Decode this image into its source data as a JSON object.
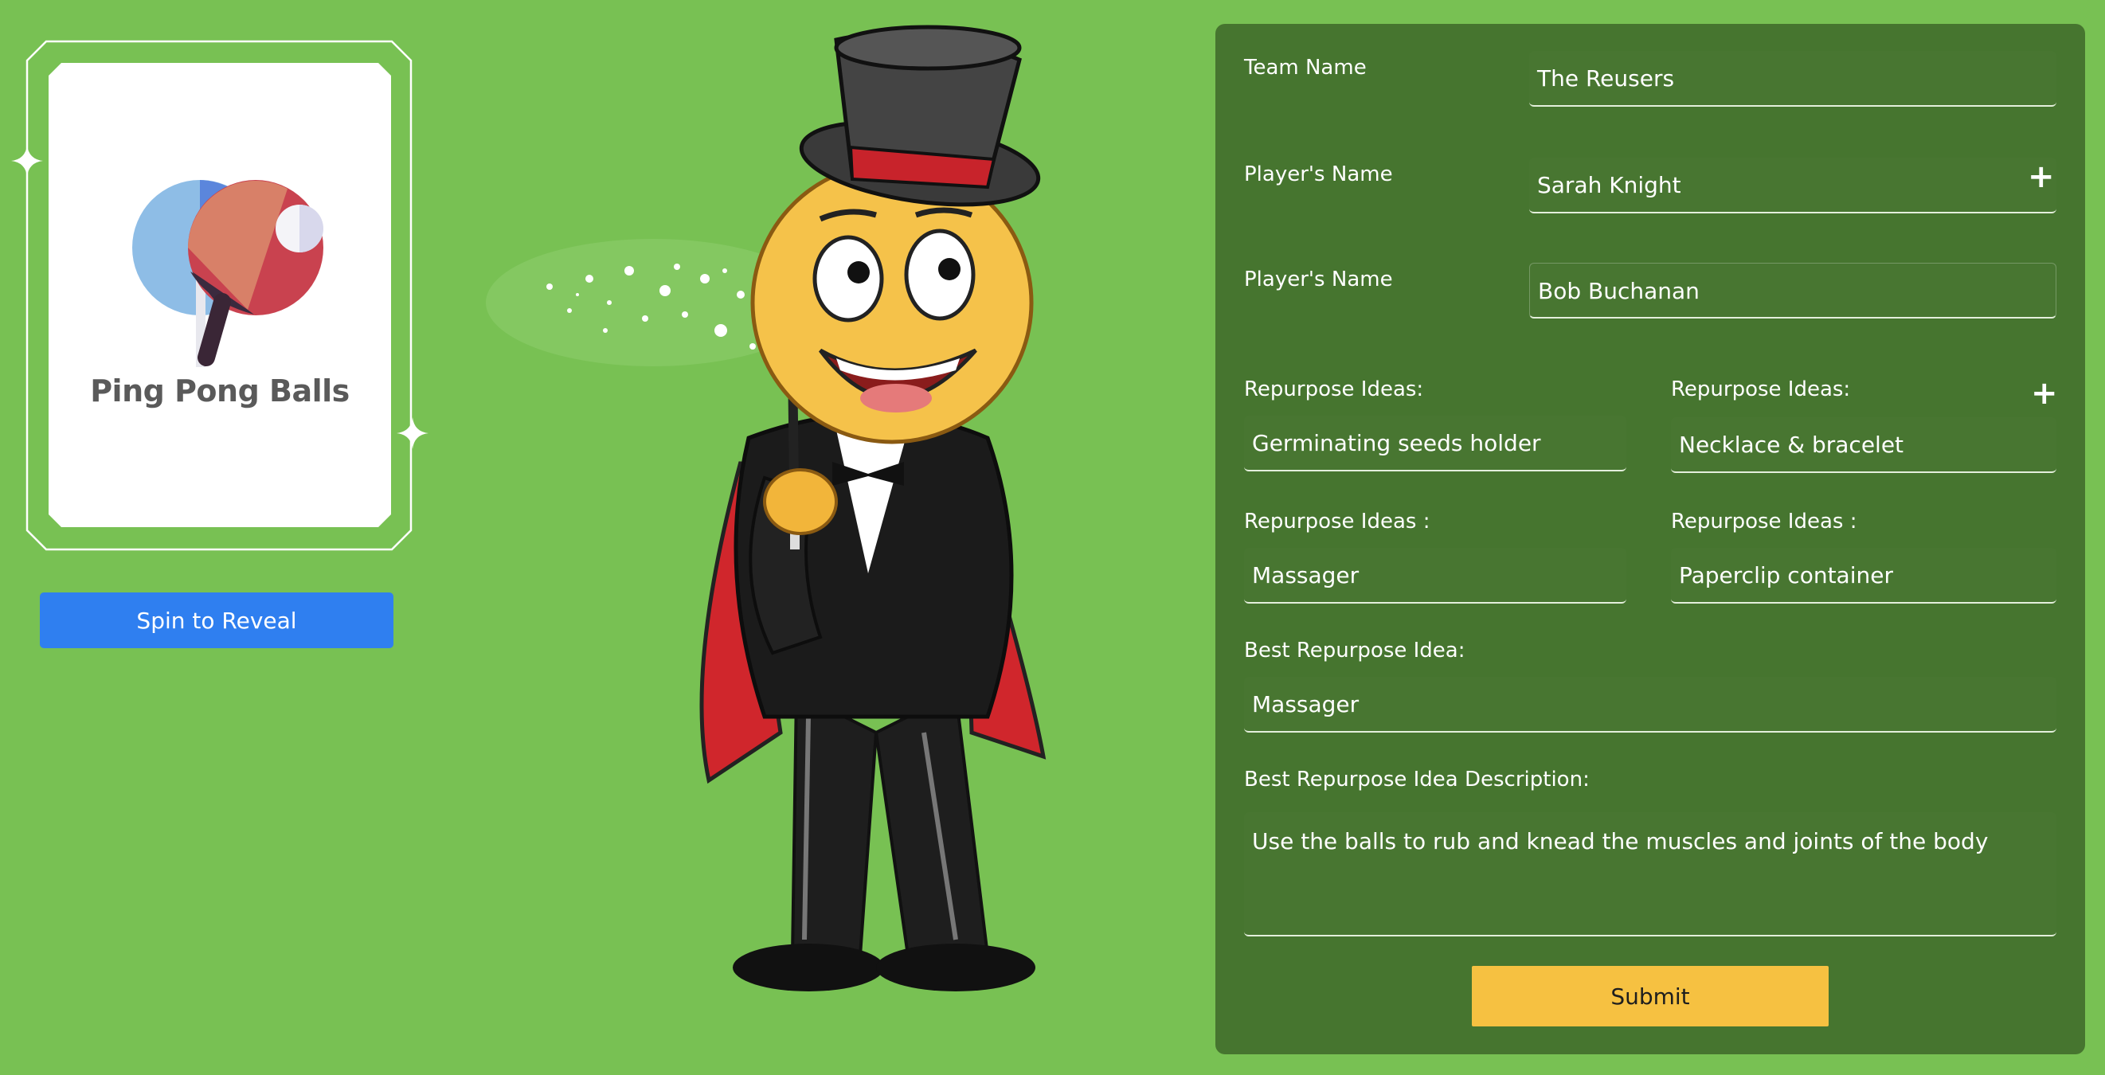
{
  "card": {
    "title": "Ping Pong Balls",
    "spin_button_label": "Spin to Reveal"
  },
  "form": {
    "team_name_label": "Team Name",
    "team_name_value": "The Reusers",
    "players": [
      {
        "label": "Player's Name",
        "value": "Sarah Knight"
      },
      {
        "label": "Player's Name",
        "value": "Bob Buchanan"
      }
    ],
    "ideas": [
      {
        "label": "Repurpose Ideas:",
        "value": "Germinating seeds holder"
      },
      {
        "label": "Repurpose Ideas:",
        "value": "Necklace & bracelet"
      },
      {
        "label": "Repurpose Ideas :",
        "value": "Massager"
      },
      {
        "label": "Repurpose Ideas :",
        "value": "Paperclip container"
      }
    ],
    "best_idea_label": "Best Repurpose Idea:",
    "best_idea_value": "Massager",
    "description_label": "Best Repurpose Idea Description:",
    "description_value": "Use the balls to rub and knead the muscles and joints of the body",
    "add_symbol": "+",
    "submit_label": "Submit"
  },
  "colors": {
    "background": "#78c153",
    "panel": "#46752f",
    "spin_button": "#2f7ff0",
    "submit_button": "#f6c141"
  }
}
